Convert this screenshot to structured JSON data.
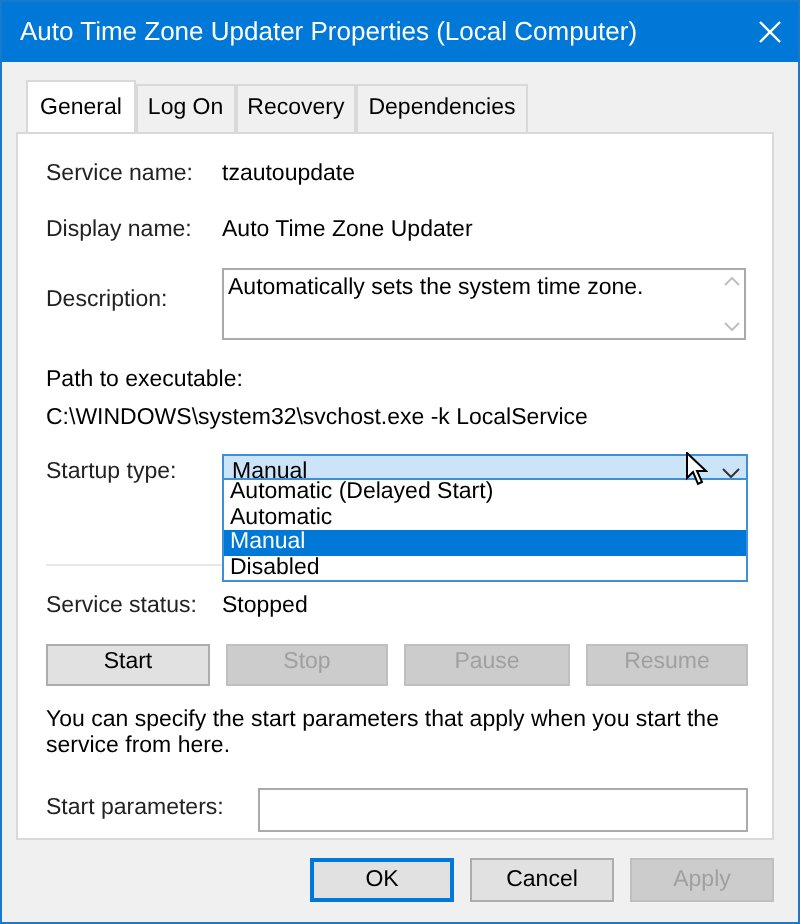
{
  "window": {
    "title": "Auto Time Zone Updater Properties (Local Computer)"
  },
  "tabs": [
    {
      "label": "General",
      "selected": true
    },
    {
      "label": "Log On",
      "selected": false
    },
    {
      "label": "Recovery",
      "selected": false
    },
    {
      "label": "Dependencies",
      "selected": false
    }
  ],
  "service_name": {
    "label": "Service name:",
    "value": "tzautoupdate"
  },
  "display_name": {
    "label": "Display name:",
    "value": "Auto Time Zone Updater"
  },
  "description": {
    "label": "Description:",
    "value": "Automatically sets the system time zone."
  },
  "path": {
    "label": "Path to executable:",
    "value": "C:\\WINDOWS\\system32\\svchost.exe -k LocalService"
  },
  "startup_type": {
    "label": "Startup type:",
    "value": "Manual",
    "expanded": true,
    "options": [
      {
        "label": "Automatic (Delayed Start)",
        "selected": false
      },
      {
        "label": "Automatic",
        "selected": false
      },
      {
        "label": "Manual",
        "selected": true
      },
      {
        "label": "Disabled",
        "selected": false
      }
    ]
  },
  "service_status": {
    "label": "Service status:",
    "value": "Stopped"
  },
  "service_buttons": [
    {
      "label": "Start",
      "disabled": false
    },
    {
      "label": "Stop",
      "disabled": true
    },
    {
      "label": "Pause",
      "disabled": true
    },
    {
      "label": "Resume",
      "disabled": true
    }
  ],
  "hint": "You can specify the start parameters that apply when you start the service from here.",
  "start_parameters": {
    "label": "Start parameters:"
  },
  "dialog_buttons": [
    {
      "label": "OK",
      "disabled": false,
      "default": true
    },
    {
      "label": "Cancel",
      "disabled": false,
      "default": false
    },
    {
      "label": "Apply",
      "disabled": true,
      "default": false
    }
  ]
}
